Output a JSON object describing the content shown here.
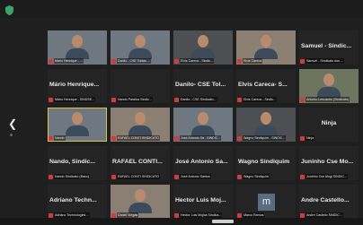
{
  "meeting": {
    "nav": {
      "prev_icon": "chevron-left-icon"
    },
    "participants": [
      {
        "name": "",
        "tag": "Mário Henrique - ...",
        "video": true,
        "tone": "video"
      },
      {
        "name": "",
        "tag": "Danilo - CSE Tobias ...",
        "video": true,
        "tone": "video"
      },
      {
        "name": "",
        "tag": "Elvis Careca - Sindic...",
        "video": true,
        "tone": "video dark"
      },
      {
        "name": "",
        "tag": "Elvis Careca",
        "video": true,
        "tone": "video warm"
      },
      {
        "name": "Samuel - Sindic...",
        "tag": "Samuel - Sindicato dos ...",
        "video": false
      },
      {
        "name": "Mário Henrique...",
        "tag": "Mário Henrique - SINDSE...",
        "video": false
      },
      {
        "name": "",
        "tag": "Nando Paraíba Sindic...",
        "video": false
      },
      {
        "name": "Danilo- CSE Tol...",
        "tag": "Danilo - CSE Sindicato...",
        "video": false
      },
      {
        "name": "Elvis Careca- S...",
        "tag": "Elvis Careca - Sindic...",
        "video": false
      },
      {
        "name": "",
        "tag": "Antonio Lencastro (Sindicato)",
        "video": true,
        "tone": "video green"
      },
      {
        "name": "",
        "tag": "Nando",
        "video": true,
        "tone": "video",
        "active": true
      },
      {
        "name": "",
        "tag": "RAFAEL CONTI SINDICATO",
        "video": true,
        "tone": "video warm"
      },
      {
        "name": "",
        "tag": "José Antonio Sá - SINDIC...",
        "video": true,
        "tone": "video"
      },
      {
        "name": "",
        "tag": "Wagno Sindiquim - SINDIC...",
        "video": true,
        "tone": "video dark"
      },
      {
        "name": "Ninja",
        "tag": "Ninja",
        "video": false,
        "center": true
      },
      {
        "name": "Nando, Sindic...",
        "tag": "Nando Sindicato (Banc)",
        "video": false
      },
      {
        "name": "RAFAEL CONTI...",
        "tag": "RAFAEL CONTI SINDICATO",
        "video": false
      },
      {
        "name": "José Antonio Sa...",
        "tag": "José Antonio Santos",
        "video": false
      },
      {
        "name": "Wagno Sindiquim",
        "tag": "Wagno Sindiquim",
        "video": false
      },
      {
        "name": "Juninho Cse Mo...",
        "tag": "Juninho Cse Mogi SINDIC...",
        "video": false
      },
      {
        "name": "Adriano Techn...",
        "tag": "Adriano Technologies ...",
        "video": false
      },
      {
        "name": "",
        "tag": "Daniel Viegas",
        "video": true,
        "tone": "video warm"
      },
      {
        "name": "Hector Luis Moj...",
        "tag": "Hector Luis Mojica Sindica...",
        "video": false
      },
      {
        "name": "",
        "tag": "Marco Ramos",
        "video": false,
        "avatar": "m"
      },
      {
        "name": "Andre Castello...",
        "tag": "Andre Castello SINDIC...",
        "video": false
      }
    ]
  }
}
